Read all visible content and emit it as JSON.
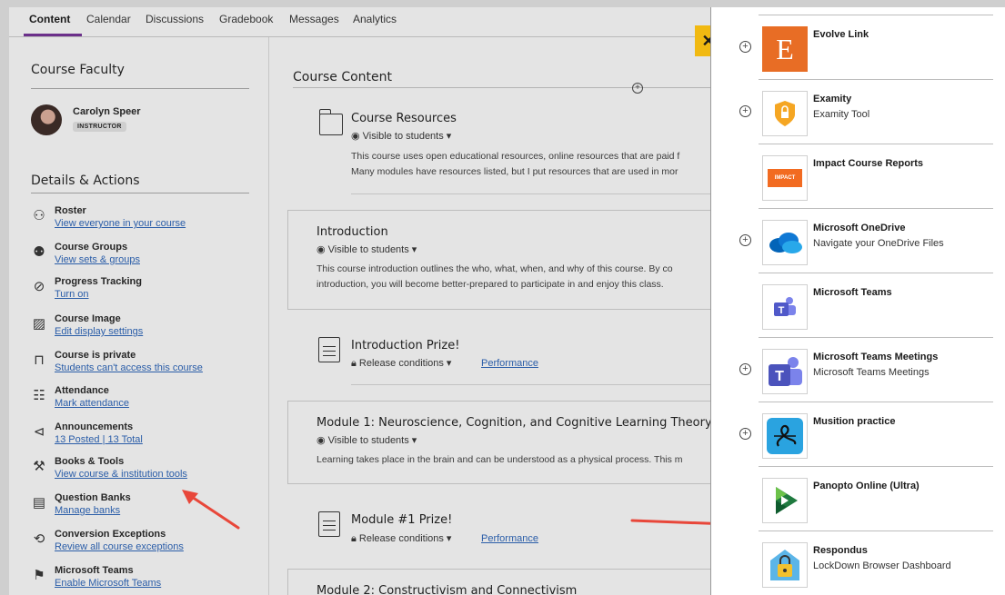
{
  "tabs": [
    "Content",
    "Calendar",
    "Discussions",
    "Gradebook",
    "Messages",
    "Analytics"
  ],
  "faculty": {
    "heading": "Course Faculty",
    "name": "Carolyn Speer",
    "role": "INSTRUCTOR"
  },
  "details": {
    "heading": "Details & Actions",
    "items": [
      {
        "title": "Roster",
        "link": "View everyone in your course",
        "icon": "roster-icon"
      },
      {
        "title": "Course Groups",
        "link": "View sets & groups",
        "icon": "groups-icon"
      },
      {
        "title": "Progress Tracking",
        "link": "Turn on",
        "icon": "progress-check-icon"
      },
      {
        "title": "Course Image",
        "link": "Edit display settings",
        "icon": "image-icon"
      },
      {
        "title": "Course is private",
        "link": "Students can't access this course",
        "icon": "lock-icon"
      },
      {
        "title": "Attendance",
        "link": "Mark attendance",
        "icon": "attendance-icon"
      },
      {
        "title": "Announcements",
        "link": "13 Posted | 13 Total",
        "icon": "megaphone-icon"
      },
      {
        "title": "Books & Tools",
        "link": "View course & institution tools",
        "icon": "wrench-icon"
      },
      {
        "title": "Question Banks",
        "link": "Manage banks",
        "icon": "question-bank-icon"
      },
      {
        "title": "Conversion Exceptions",
        "link": "Review all course exceptions",
        "icon": "exception-icon"
      },
      {
        "title": "Microsoft Teams",
        "link": "Enable Microsoft Teams",
        "icon": "teams-icon"
      }
    ]
  },
  "content": {
    "heading": "Course Content",
    "resources": {
      "title": "Course Resources",
      "visibility": "Visible to students",
      "desc1": "This course uses open educational resources, online resources that are paid f",
      "desc2": "Many modules have resources listed, but I put resources that are used in mor"
    },
    "intro": {
      "title": "Introduction",
      "visibility": "Visible to students",
      "desc1": "This course introduction outlines the who, what, when, and why of this course. By co",
      "desc2": "introduction, you will become better-prepared to participate in and enjoy this class."
    },
    "intro_prize": {
      "title": "Introduction Prize!",
      "release": "Release conditions",
      "perf": "Performance"
    },
    "module1": {
      "title": "Module 1: Neuroscience, Cognition, and Cognitive Learning Theory",
      "visibility": "Visible to students",
      "desc1": "Learning takes place in the brain and can be understood as a physical process. This m"
    },
    "module1_prize": {
      "title": "Module #1 Prize!",
      "release": "Release conditions",
      "perf": "Performance"
    },
    "module2": {
      "title": "Module 2: Constructivism and Connectivism"
    }
  },
  "tools_panel": {
    "close": "✕",
    "tools": [
      {
        "name": "Evolve Link",
        "sub": "",
        "plus": true,
        "logo": "E"
      },
      {
        "name": "Examity",
        "sub": "Examity Tool",
        "plus": true,
        "logo": ""
      },
      {
        "name": "Impact Course Reports",
        "sub": "",
        "plus": false,
        "logo": "IMPACT"
      },
      {
        "name": "Microsoft OneDrive",
        "sub": "Navigate your OneDrive Files",
        "plus": true,
        "logo": ""
      },
      {
        "name": "Microsoft Teams",
        "sub": "",
        "plus": false,
        "logo": ""
      },
      {
        "name": "Microsoft Teams Meetings",
        "sub": "Microsoft Teams Meetings",
        "plus": true,
        "logo": ""
      },
      {
        "name": "Musition practice",
        "sub": "",
        "plus": true,
        "logo": ""
      },
      {
        "name": "Panopto Online (Ultra)",
        "sub": "",
        "plus": false,
        "logo": ""
      },
      {
        "name": "Respondus",
        "sub": "LockDown Browser Dashboard",
        "plus": false,
        "logo": ""
      }
    ]
  },
  "colors": {
    "accent": "#6b2f8a",
    "link": "#2a5da8",
    "close_bg": "#f1b911",
    "arrow": "#e8473a"
  }
}
